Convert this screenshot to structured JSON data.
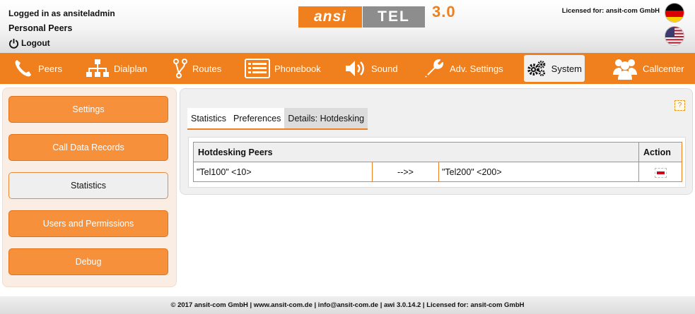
{
  "header": {
    "logged_in_as": "Logged in as ansiteladmin",
    "personal_peers": "Personal Peers",
    "logout": "Logout",
    "logo_left": "ansi",
    "logo_right": "TEL",
    "logo_version": "3.0",
    "licensed_for": "Licensed for: ansit-com GmbH",
    "flags": [
      "german-flag-icon",
      "us-flag-icon"
    ]
  },
  "nav": {
    "items": [
      {
        "label": "Peers",
        "icon": "phone-icon"
      },
      {
        "label": "Dialplan",
        "icon": "sitemap-icon"
      },
      {
        "label": "Routes",
        "icon": "routes-icon"
      },
      {
        "label": "Phonebook",
        "icon": "list-icon"
      },
      {
        "label": "Sound",
        "icon": "speaker-icon"
      },
      {
        "label": "Adv. Settings",
        "icon": "wrench-icon"
      },
      {
        "label": "System",
        "icon": "gears-icon",
        "active": true
      },
      {
        "label": "Callcenter",
        "icon": "users-icon"
      }
    ]
  },
  "sidebar": {
    "items": [
      {
        "label": "Settings"
      },
      {
        "label": "Call Data Records"
      },
      {
        "label": "Statistics",
        "active": true
      },
      {
        "label": "Users and Permissions"
      },
      {
        "label": "Debug"
      }
    ]
  },
  "main": {
    "help": "?",
    "tabs": [
      {
        "label": "Statistics"
      },
      {
        "label": "Preferences"
      },
      {
        "label": "Details: Hotdesking",
        "active": true
      }
    ],
    "table": {
      "headers": [
        "Hotdesking Peers",
        "Action"
      ],
      "rows": [
        {
          "from": "\"Tel100\" <10>",
          "arrow": "-->>",
          "to": "\"Tel200\" <200>"
        }
      ]
    }
  },
  "footer": {
    "text": "© 2017 ansit-com GmbH | www.ansit-com.de | info@ansit-com.de | awi 3.0.14.2 | Licensed for: ansit-com GmbH"
  },
  "colors": {
    "accent": "#f07f1e",
    "button": "#f7903a",
    "delete": "#d0021b"
  }
}
